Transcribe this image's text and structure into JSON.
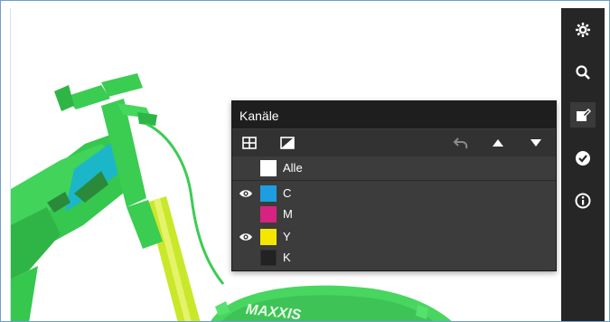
{
  "panel": {
    "title": "Kanäle",
    "toolbar": {
      "left_icons": [
        "grid-icon",
        "contrast-icon"
      ],
      "right_icons": [
        "undo-icon",
        "arrow-up-icon",
        "arrow-down-icon"
      ]
    },
    "channels": [
      {
        "label": "Alle",
        "visible": false,
        "color": "#ffffff"
      },
      {
        "label": "C",
        "visible": true,
        "color": "#1e9ee0"
      },
      {
        "label": "M",
        "visible": false,
        "color": "#d6237f"
      },
      {
        "label": "Y",
        "visible": true,
        "color": "#f5e600"
      },
      {
        "label": "K",
        "visible": false,
        "color": "#222222"
      }
    ]
  },
  "right_toolbar": {
    "icons": [
      "settings-icon",
      "search-icon",
      "edit-icon",
      "check-circle-icon",
      "info-icon"
    ]
  },
  "canvas": {
    "tire_text": "MAXXIS",
    "bike_color": "#3fcf55",
    "fork_color": "#c9e82a",
    "tube_color": "#1fb4c8"
  }
}
